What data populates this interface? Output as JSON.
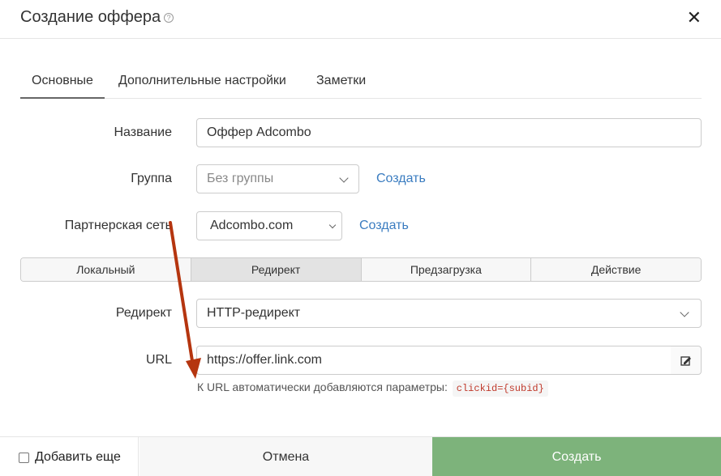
{
  "dialog": {
    "title": "Создание оффера",
    "help_icon": "?"
  },
  "tabs": [
    {
      "label": "Основные",
      "active": true
    },
    {
      "label": "Дополнительные настройки",
      "active": false
    },
    {
      "label": "Заметки",
      "active": false
    }
  ],
  "form": {
    "name_label": "Название",
    "name_value": "Оффер Adcombo",
    "group_label": "Группа",
    "group_value": "Без группы",
    "group_create": "Создать",
    "network_label": "Партнерская сеть",
    "network_value": "Adcombo.com",
    "network_create": "Создать",
    "modes": [
      {
        "label": "Локальный",
        "active": false
      },
      {
        "label": "Редирект",
        "active": true
      },
      {
        "label": "Предзагрузка",
        "active": false
      },
      {
        "label": "Действие",
        "active": false
      }
    ],
    "redirect_label": "Редирект",
    "redirect_value": "HTTP-редирект",
    "url_label": "URL",
    "url_value": "https://offer.link.com",
    "hint_text": "К URL автоматически добавляются параметры:",
    "hint_code": "clickid={subid}"
  },
  "footer": {
    "add_more": "Добавить еще",
    "cancel": "Отмена",
    "create": "Создать"
  },
  "colors": {
    "accent_link": "#3a7cc0",
    "create_button": "#7db37b",
    "annotation_arrow": "#b5350f"
  }
}
